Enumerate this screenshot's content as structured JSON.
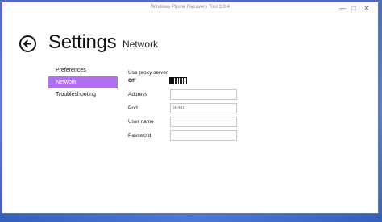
{
  "window": {
    "title": "Windows Phone Recovery Tool 3.0.4",
    "minimize_glyph": "—",
    "maximize_glyph": "□",
    "close_glyph": "✕"
  },
  "header": {
    "back_icon": "arrow-left-icon",
    "title": "Settings",
    "subtitle": "Network"
  },
  "nav": {
    "items": [
      {
        "label": "Preferences",
        "active": false
      },
      {
        "label": "Network",
        "active": true
      },
      {
        "label": "Troubleshooting",
        "active": false
      }
    ]
  },
  "network": {
    "proxy_label": "Use proxy server",
    "proxy_state": "Off",
    "proxy_enabled": false,
    "fields": [
      {
        "label": "Address",
        "value": "",
        "placeholder": ""
      },
      {
        "label": "Port",
        "value": "",
        "placeholder": "8080"
      },
      {
        "label": "User name",
        "value": "",
        "placeholder": ""
      },
      {
        "label": "Password",
        "value": "",
        "placeholder": ""
      }
    ]
  },
  "colors": {
    "accent": "#b06ef0",
    "window_border": "#7a62c8",
    "desktop": "#4a6fb4"
  }
}
